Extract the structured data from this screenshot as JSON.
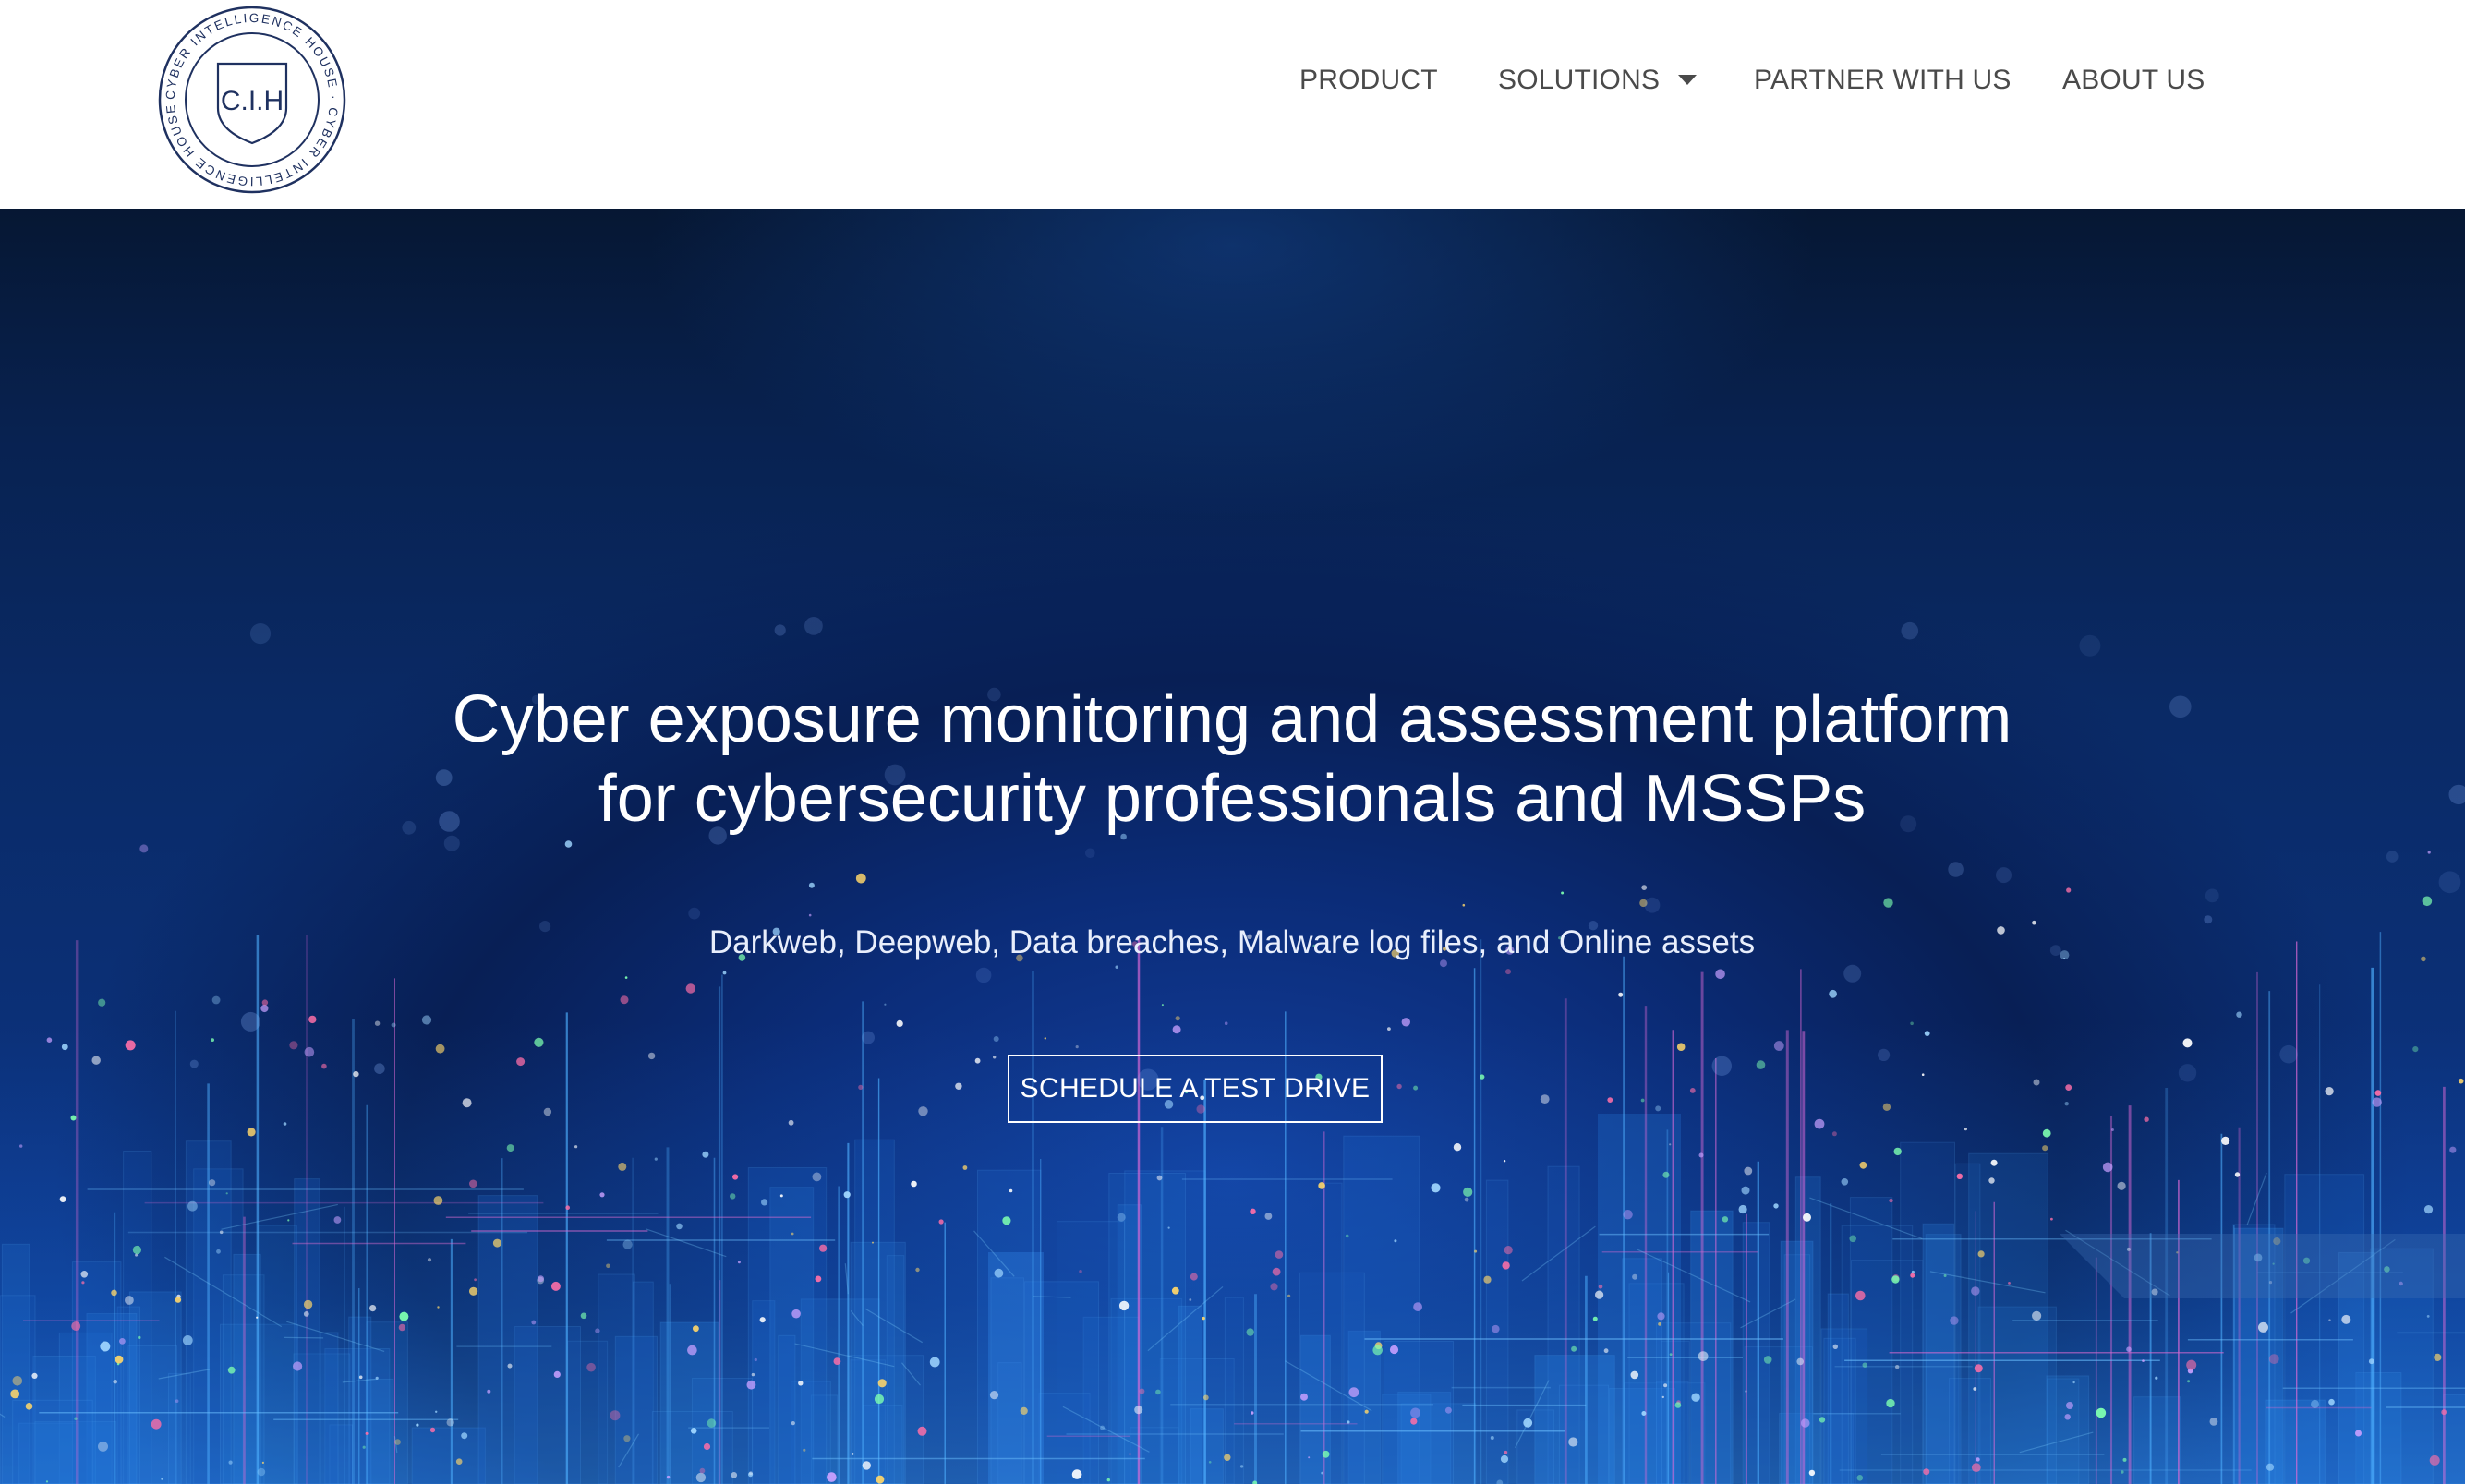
{
  "brand": {
    "logo_text": "C.I.H",
    "logo_ring_text": "CYBER INTELLIGENCE HOUSE · CYBER INTELLIGENCE HOUSE · "
  },
  "nav": {
    "items": [
      {
        "label": "PRODUCT"
      },
      {
        "label": "SOLUTIONS"
      },
      {
        "label": "PARTNER WITH US"
      },
      {
        "label": "ABOUT US"
      }
    ]
  },
  "hero": {
    "title_line1": "Cyber exposure monitoring and assessment platform",
    "title_line2": "for cybersecurity professionals and MSSPs",
    "subtitle": "Darkweb, Deepweb, Data breaches, Malware log files, and Online assets",
    "cta_label": "SCHEDULE A TEST DRIVE"
  },
  "colors": {
    "nav_text": "#4a4a4a",
    "logo_navy": "#1f3160",
    "hero_dark": "#061733",
    "hero_mid": "#0b2f74",
    "hero_glow": "#123f9e",
    "cta_border": "#ffffff"
  },
  "icons": {
    "solutions_dropdown": "caret-down-icon",
    "logo": "shield-seal-logo"
  }
}
